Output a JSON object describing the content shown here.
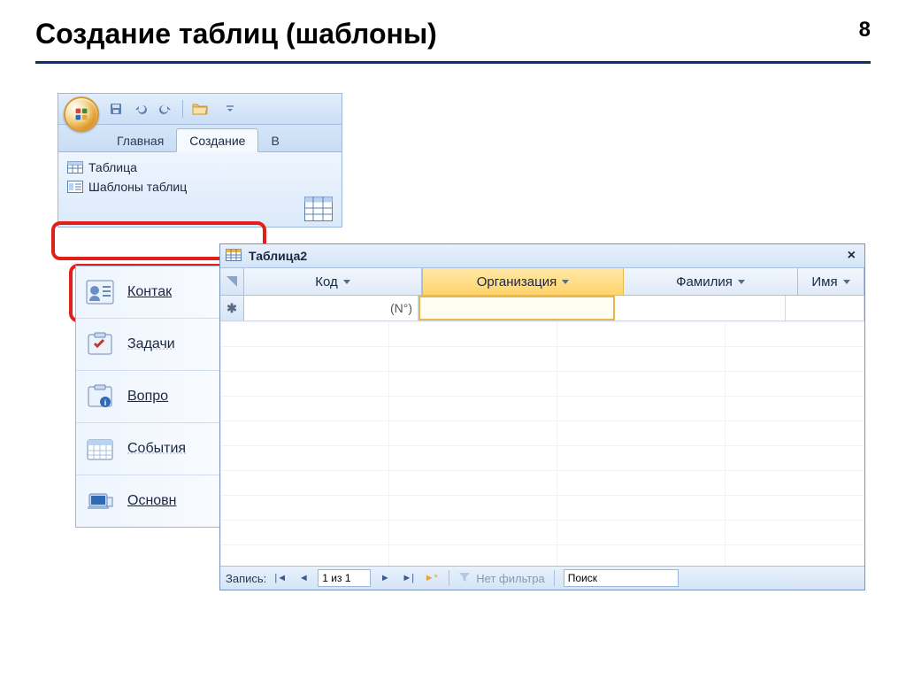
{
  "slide": {
    "title": "Создание таблиц (шаблоны)",
    "page_number": "8"
  },
  "ribbon": {
    "tabs": {
      "home": "Главная",
      "create": "Создание",
      "next_prefix": "В"
    },
    "items": {
      "table": "Таблица",
      "table_templates": "Шаблоны таблиц"
    }
  },
  "templates": {
    "contacts": "Контак",
    "tasks": "Задачи",
    "issues": "Вопро",
    "events": "События",
    "assets": "Основн"
  },
  "datasheet": {
    "tab_title": "Таблица2",
    "columns": {
      "id": "Код",
      "company": "Организация",
      "lastname": "Фамилия",
      "firstname": "Имя"
    },
    "new_row_id": "(N°)",
    "status": {
      "record_label": "Запись:",
      "position": "1 из 1",
      "no_filter": "Нет фильтра",
      "search": "Поиск"
    }
  }
}
